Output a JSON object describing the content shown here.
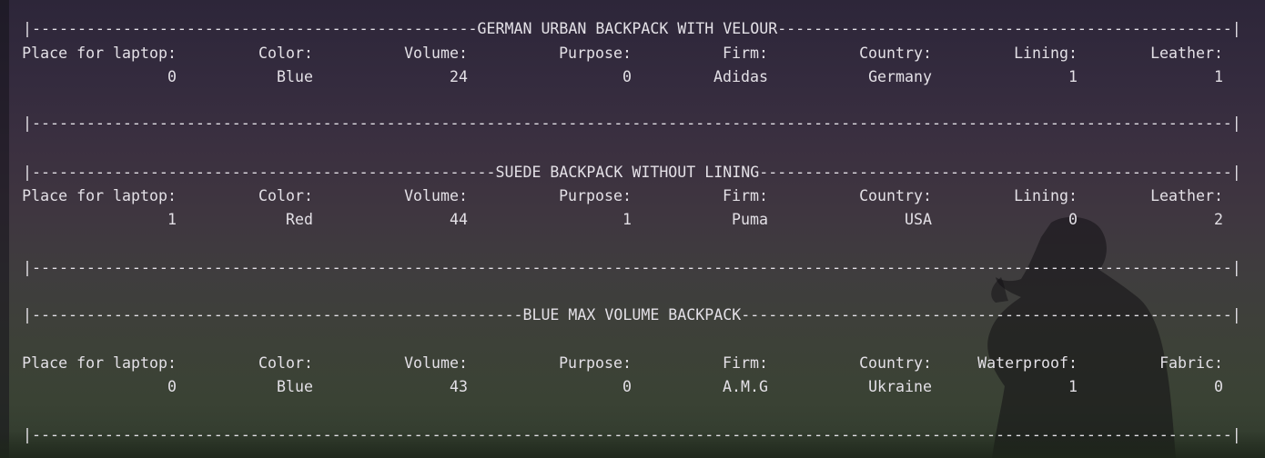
{
  "sections": [
    {
      "title": "GERMAN URBAN BACKPACK WITH VELOUR",
      "headers": [
        "Place for laptop:",
        "Color:",
        "Volume:",
        "Purpose:",
        "Firm:",
        "Country:",
        "Lining:",
        "Leather:"
      ],
      "values": [
        "0",
        "Blue",
        "24",
        "0",
        "Adidas",
        "Germany",
        "1",
        "1"
      ]
    },
    {
      "title": "SUEDE BACKPACK WITHOUT LINING",
      "headers": [
        "Place for laptop:",
        "Color:",
        "Volume:",
        "Purpose:",
        "Firm:",
        "Country:",
        "Lining:",
        "Leather:"
      ],
      "values": [
        "1",
        "Red",
        "44",
        "1",
        "Puma",
        "USA",
        "0",
        "2"
      ]
    },
    {
      "title": "BLUE MAX VOLUME BACKPACK",
      "headers": [
        "Place for laptop:",
        "Color:",
        "Volume:",
        "Purpose:",
        "Firm:",
        "Country:",
        "Waterproof:",
        "Fabric:"
      ],
      "values": [
        "0",
        "Blue",
        "43",
        "0",
        "A.M.G",
        "Ukraine",
        "1",
        "0"
      ]
    }
  ],
  "colors": {
    "text": "#e3e0e6",
    "background_top": "#2d2639",
    "background_bottom": "#2f3a2c"
  }
}
